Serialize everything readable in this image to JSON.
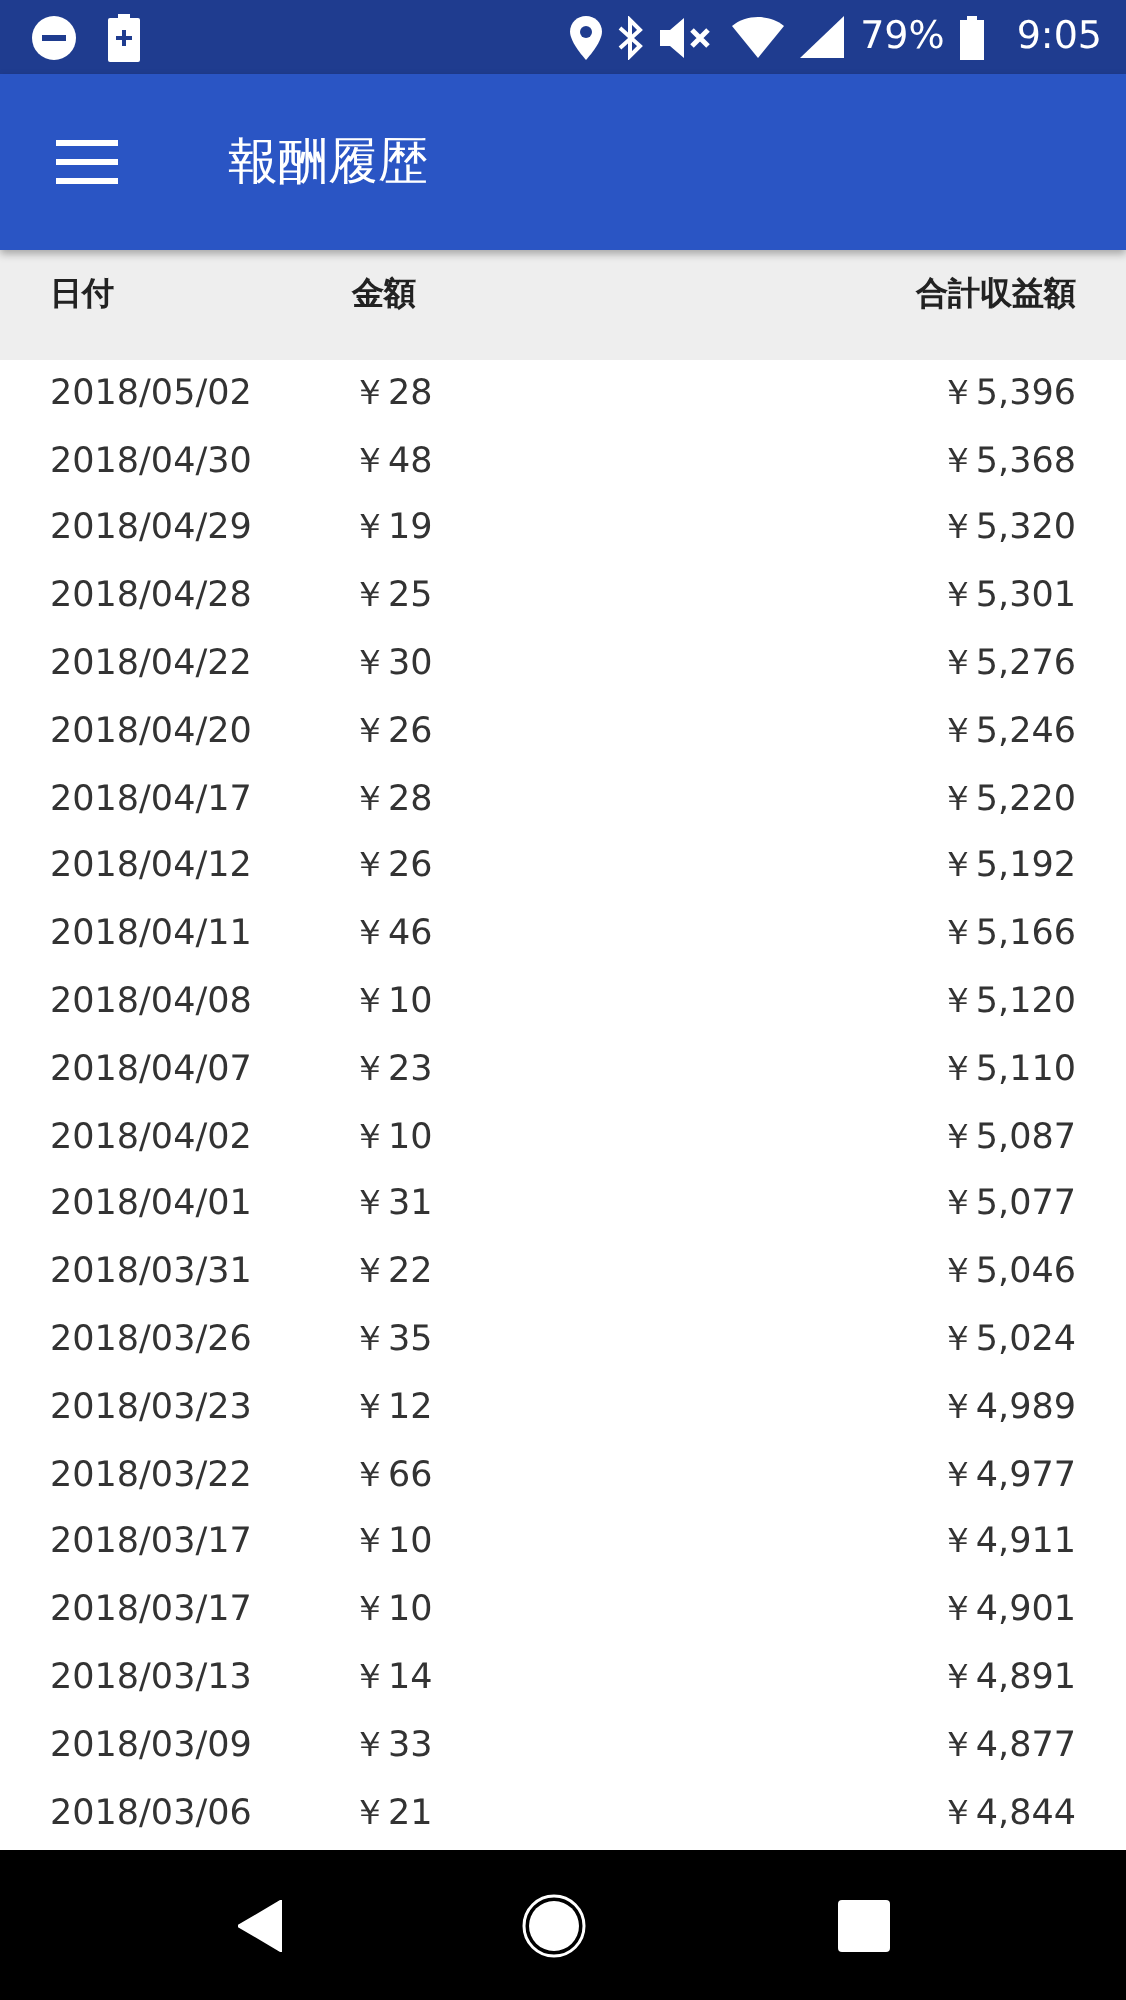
{
  "status_bar": {
    "battery_percent": "79%",
    "time": "9:05"
  },
  "app_bar": {
    "title": "報酬履歴"
  },
  "table": {
    "columns": [
      "日付",
      "金額",
      "合計収益額"
    ],
    "rows": [
      [
        "2018/05/02",
        "￥28",
        "￥5,396"
      ],
      [
        "2018/04/30",
        "￥48",
        "￥5,368"
      ],
      [
        "2018/04/29",
        "￥19",
        "￥5,320"
      ],
      [
        "2018/04/28",
        "￥25",
        "￥5,301"
      ],
      [
        "2018/04/22",
        "￥30",
        "￥5,276"
      ],
      [
        "2018/04/20",
        "￥26",
        "￥5,246"
      ],
      [
        "2018/04/17",
        "￥28",
        "￥5,220"
      ],
      [
        "2018/04/12",
        "￥26",
        "￥5,192"
      ],
      [
        "2018/04/11",
        "￥46",
        "￥5,166"
      ],
      [
        "2018/04/08",
        "￥10",
        "￥5,120"
      ],
      [
        "2018/04/07",
        "￥23",
        "￥5,110"
      ],
      [
        "2018/04/02",
        "￥10",
        "￥5,087"
      ],
      [
        "2018/04/01",
        "￥31",
        "￥5,077"
      ],
      [
        "2018/03/31",
        "￥22",
        "￥5,046"
      ],
      [
        "2018/03/26",
        "￥35",
        "￥5,024"
      ],
      [
        "2018/03/23",
        "￥12",
        "￥4,989"
      ],
      [
        "2018/03/22",
        "￥66",
        "￥4,977"
      ],
      [
        "2018/03/17",
        "￥10",
        "￥4,911"
      ],
      [
        "2018/03/17",
        "￥10",
        "￥4,901"
      ],
      [
        "2018/03/13",
        "￥14",
        "￥4,891"
      ],
      [
        "2018/03/09",
        "￥33",
        "￥4,877"
      ],
      [
        "2018/03/06",
        "￥21",
        "￥4,844"
      ]
    ]
  }
}
